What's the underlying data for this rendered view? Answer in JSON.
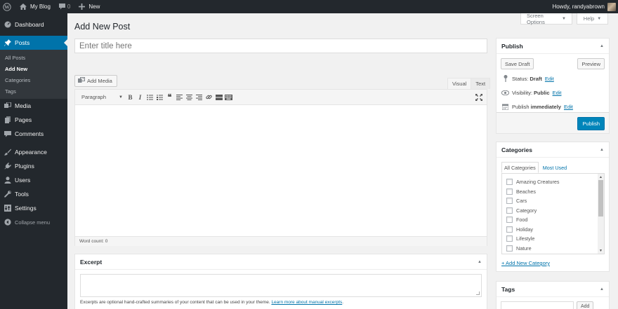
{
  "adminbar": {
    "site_name": "My Blog",
    "comments_count": "0",
    "new_label": "New",
    "greeting": "Howdy, randyabrown"
  },
  "sidebar": {
    "items": [
      {
        "label": "Dashboard",
        "icon": "dashboard-icon"
      },
      {
        "label": "Posts",
        "icon": "pushpin-icon",
        "current": true
      },
      {
        "label": "Media",
        "icon": "media-icon"
      },
      {
        "label": "Pages",
        "icon": "pages-icon"
      },
      {
        "label": "Comments",
        "icon": "comment-icon"
      },
      {
        "label": "Appearance",
        "icon": "paintbrush-icon"
      },
      {
        "label": "Plugins",
        "icon": "plug-icon"
      },
      {
        "label": "Users",
        "icon": "user-icon"
      },
      {
        "label": "Tools",
        "icon": "wrench-icon"
      },
      {
        "label": "Settings",
        "icon": "settings-icon"
      },
      {
        "label": "Collapse menu",
        "icon": "collapse-icon"
      }
    ],
    "posts_submenu": [
      "All Posts",
      "Add New",
      "Categories",
      "Tags"
    ]
  },
  "screen_meta": {
    "screen_options": "Screen Options",
    "help": "Help"
  },
  "page": {
    "title": "Add New Post",
    "title_placeholder": "Enter title here"
  },
  "editor": {
    "add_media": "Add Media",
    "tab_visual": "Visual",
    "tab_text": "Text",
    "format_select": "Paragraph",
    "word_count": "Word count: 0"
  },
  "excerpt": {
    "heading": "Excerpt",
    "help_text": "Excerpts are optional hand-crafted summaries of your content that can be used in your theme.",
    "help_link": "Learn more about manual excerpts"
  },
  "publish": {
    "heading": "Publish",
    "save_draft": "Save Draft",
    "preview": "Preview",
    "status_label": "Status:",
    "status_value": "Draft",
    "visibility_label": "Visibility:",
    "visibility_value": "Public",
    "schedule_label": "Publish",
    "schedule_value": "immediately",
    "edit_link": "Edit",
    "publish_button": "Publish",
    "accent_color": "#0085ba"
  },
  "categories": {
    "heading": "Categories",
    "tab_all": "All Categories",
    "tab_most_used": "Most Used",
    "items": [
      "Amazing Creatures",
      "Beaches",
      "Cars",
      "Category",
      "Food",
      "Holiday",
      "Lifestyle",
      "Nature"
    ],
    "add_new": "+ Add New Category"
  },
  "tags": {
    "heading": "Tags",
    "add_button": "Add"
  }
}
